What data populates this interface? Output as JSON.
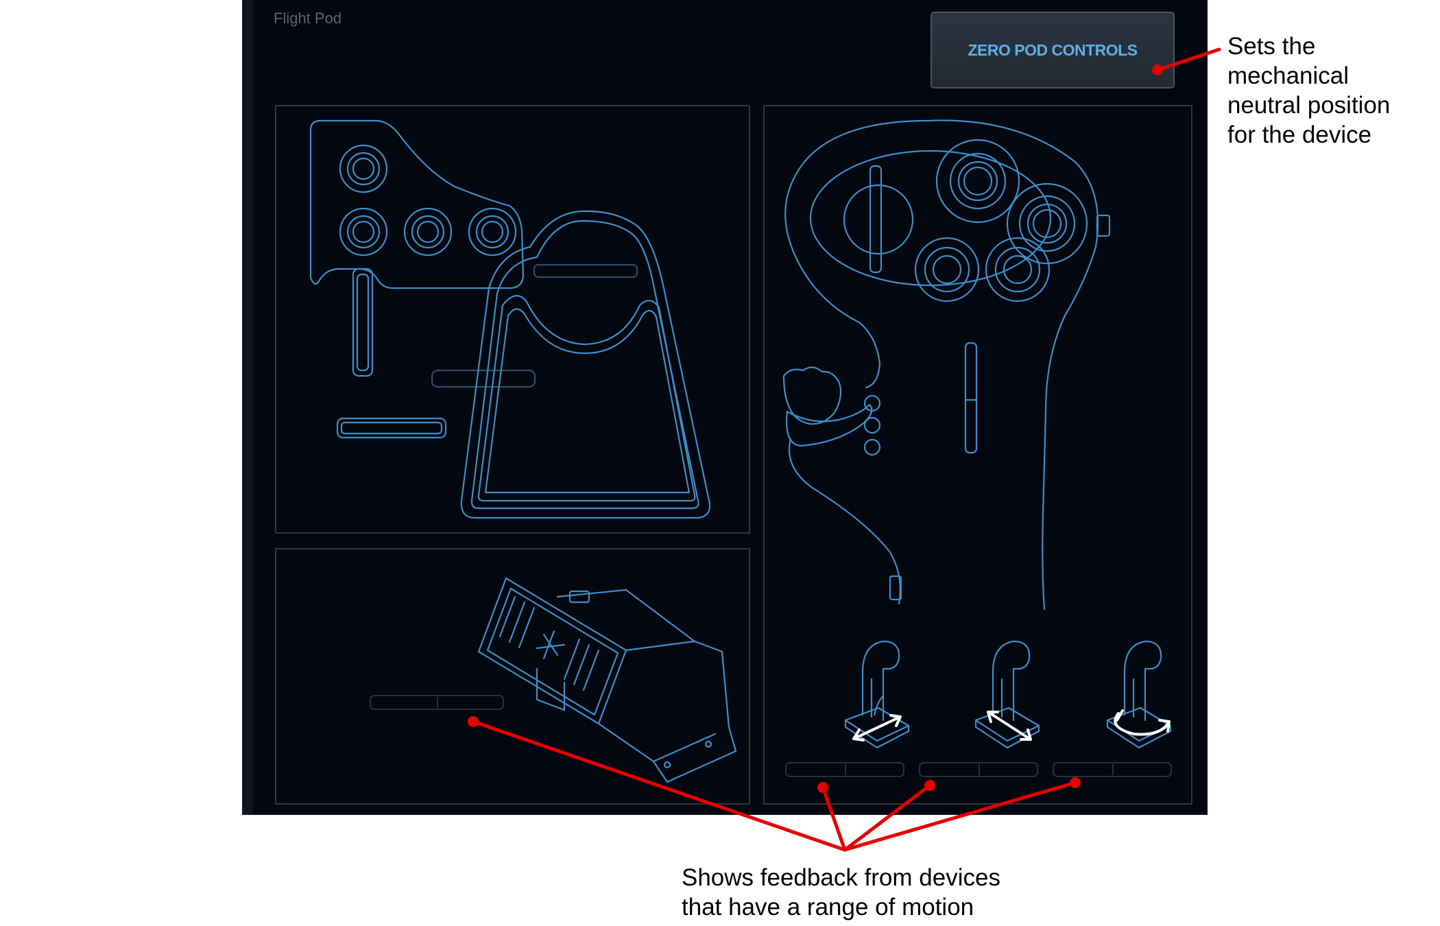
{
  "window": {
    "title": "Flight Pod"
  },
  "actions": {
    "zero_pod_controls_label": "ZERO POD CONTROLS"
  },
  "devices": {
    "throttle": {
      "icon": "throttle-quadrant-icon"
    },
    "pedals": {
      "icon": "rudder-pedals-icon",
      "meter_value": 0.5
    },
    "stick": {
      "icon": "joystick-icon",
      "axes": [
        {
          "icon": "stick-axis-x-icon",
          "meter_value": 0.5
        },
        {
          "icon": "stick-axis-y-icon",
          "meter_value": 0.5
        },
        {
          "icon": "stick-twist-icon",
          "meter_value": 0.5
        }
      ]
    }
  },
  "annotations": {
    "zero_controls": "Sets the\nmechanical\nneutral position\nfor the device",
    "feedback": "Shows feedback from devices\nthat have a range of motion"
  },
  "colors": {
    "outline": "#3d8fc9",
    "background": "#03070f",
    "accent_text": "#5fb0e6",
    "annotation_line": "#e60000"
  }
}
